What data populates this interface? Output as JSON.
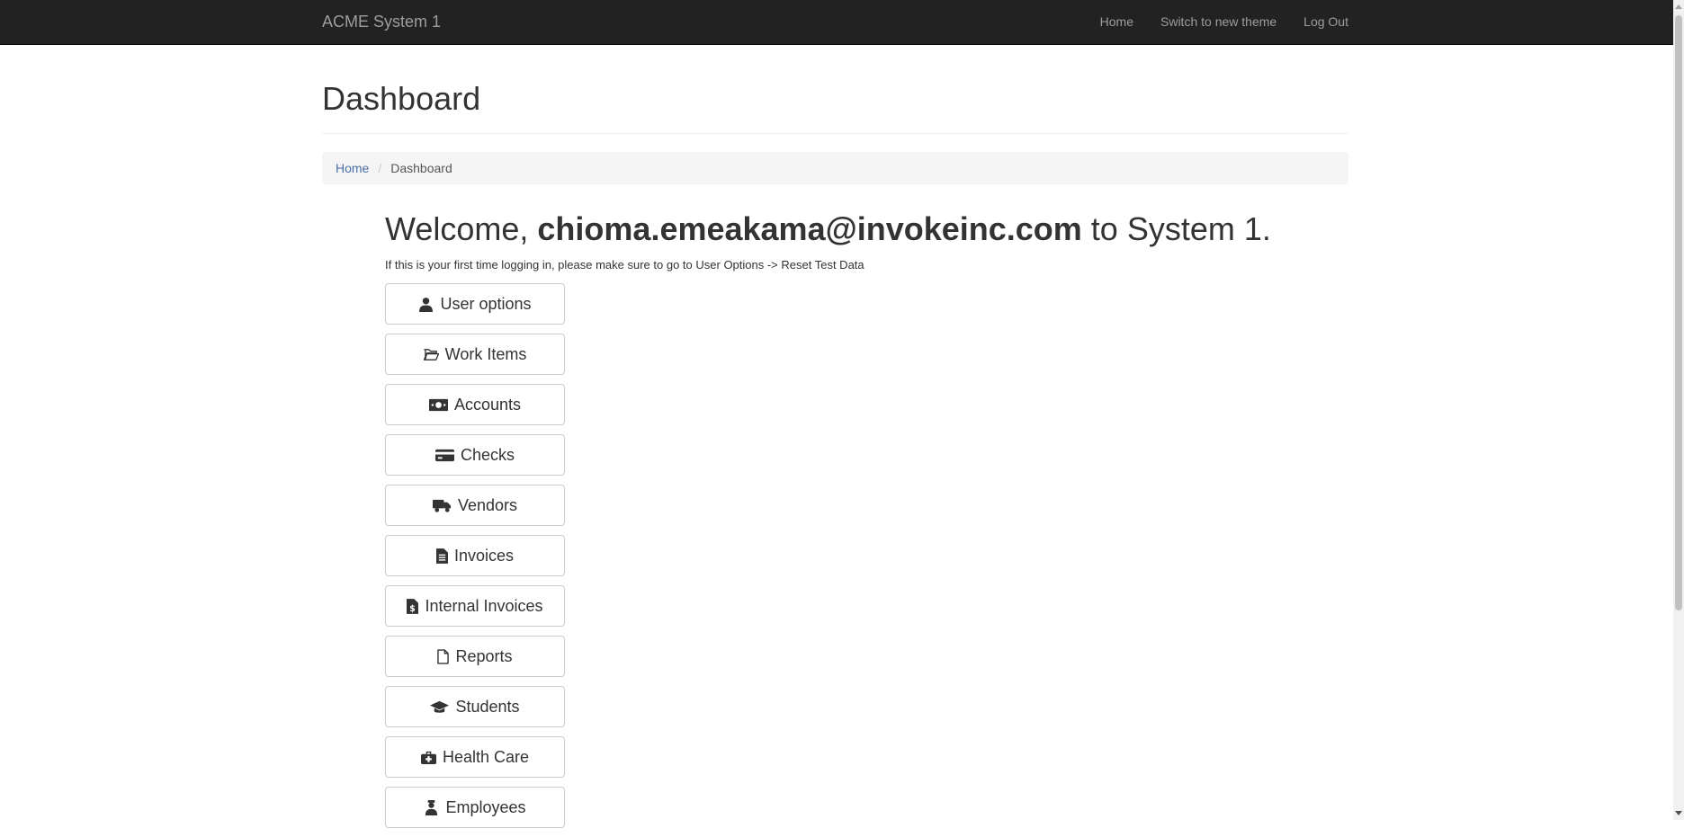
{
  "navbar": {
    "brand": "ACME System 1",
    "links": [
      {
        "label": "Home"
      },
      {
        "label": "Switch to new theme"
      },
      {
        "label": "Log Out"
      }
    ]
  },
  "page": {
    "title": "Dashboard"
  },
  "breadcrumb": {
    "home": "Home",
    "current": "Dashboard"
  },
  "welcome": {
    "prefix": "Welcome,",
    "user": "chioma.emeakama@invokeinc.com",
    "suffix": "to System 1.",
    "hint": "If this is your first time logging in, please make sure to go to User Options -> Reset Test Data"
  },
  "buttons": [
    {
      "label": "User options",
      "icon": "user-icon"
    },
    {
      "label": "Work Items",
      "icon": "folder-open-icon"
    },
    {
      "label": "Accounts",
      "icon": "money-bill-icon"
    },
    {
      "label": "Checks",
      "icon": "credit-card-icon"
    },
    {
      "label": "Vendors",
      "icon": "truck-icon"
    },
    {
      "label": "Invoices",
      "icon": "file-invoice-icon"
    },
    {
      "label": "Internal Invoices",
      "icon": "file-invoice-dollar-icon"
    },
    {
      "label": "Reports",
      "icon": "file-icon"
    },
    {
      "label": "Students",
      "icon": "graduation-cap-icon"
    },
    {
      "label": "Health Care",
      "icon": "medical-kit-icon"
    },
    {
      "label": "Employees",
      "icon": "user-nurse-icon"
    }
  ]
}
